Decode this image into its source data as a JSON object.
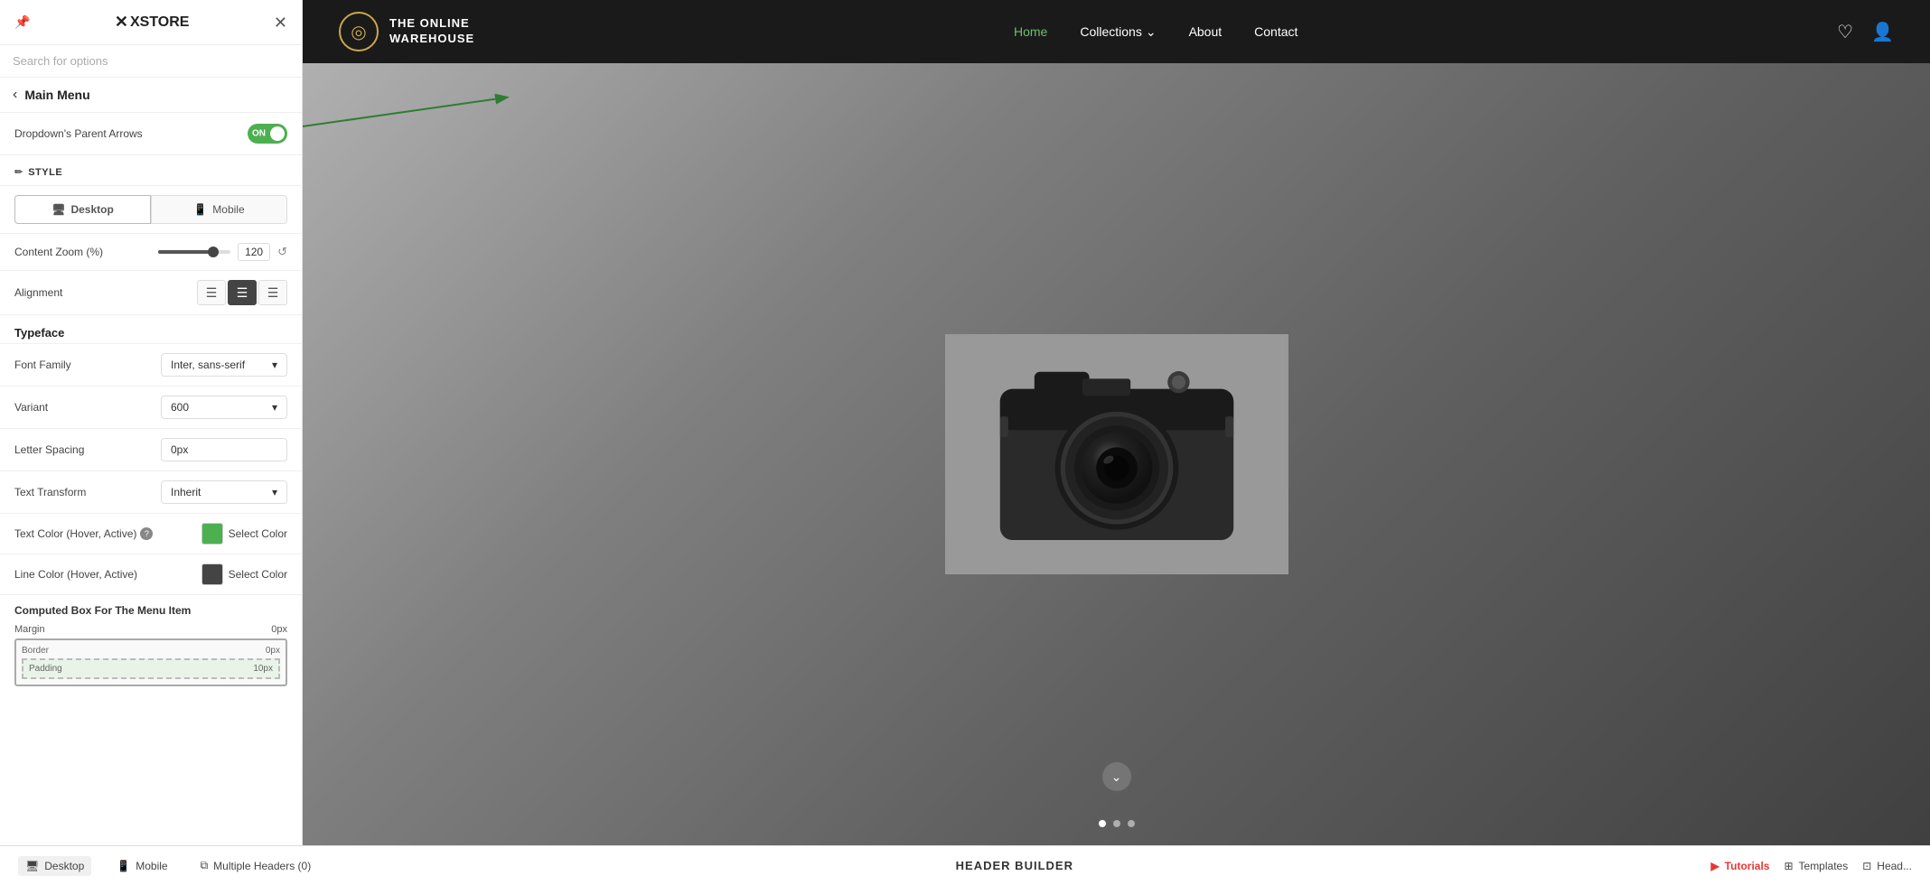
{
  "panel": {
    "logo": "XSTORE",
    "search_placeholder": "Search for options",
    "back_label": "Main Menu",
    "toggle_label": "Dropdown's Parent Arrows",
    "toggle_state": "ON",
    "style_section": "STYLE",
    "device_tabs": [
      {
        "label": "Desktop",
        "icon": "🖥",
        "active": true
      },
      {
        "label": "Mobile",
        "icon": "📱",
        "active": false
      }
    ],
    "content_zoom_label": "Content Zoom (%)",
    "content_zoom_value": "120",
    "alignment_label": "Alignment",
    "typeface_label": "Typeface",
    "font_family_label": "Font Family",
    "font_family_value": "Inter, sans-serif",
    "variant_label": "Variant",
    "variant_value": "600",
    "letter_spacing_label": "Letter Spacing",
    "letter_spacing_value": "0px",
    "text_transform_label": "Text Transform",
    "text_transform_value": "Inherit",
    "text_color_label": "Text Color (Hover, Active)",
    "text_color_select": "Select Color",
    "line_color_label": "Line Color (Hover, Active)",
    "line_color_select": "Select Color",
    "computed_title": "Computed Box For The Menu Item",
    "margin_label": "Margin",
    "margin_value": "0px",
    "border_label": "Border",
    "border_value": "0px",
    "padding_label": "Padding",
    "padding_value": "10px"
  },
  "site": {
    "logo_text_line1": "THE ONLINE",
    "logo_text_line2": "WAREHOUSE",
    "nav_items": [
      {
        "label": "Home",
        "active": true
      },
      {
        "label": "Collections",
        "has_arrow": true
      },
      {
        "label": "About"
      },
      {
        "label": "Contact"
      }
    ]
  },
  "bottom_toolbar": {
    "desktop_label": "Desktop",
    "mobile_label": "Mobile",
    "multiple_headers_label": "Multiple Headers (0)",
    "header_builder_label": "HEADER BUILDER",
    "tutorials_label": "Tutorials",
    "templates_label": "Templates",
    "head_label": "Head..."
  },
  "hero": {
    "dots": [
      {
        "active": true
      },
      {
        "active": false
      },
      {
        "active": false
      }
    ]
  }
}
